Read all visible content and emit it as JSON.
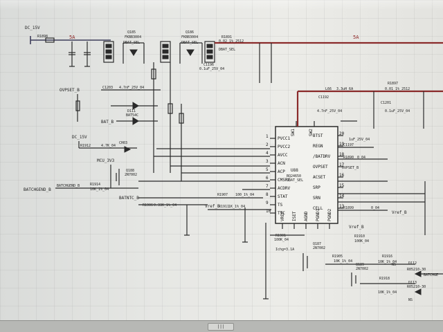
{
  "net": {
    "dc_15v_top": "DC_15V",
    "current_5a_left": "5A",
    "current_5a_right": "5A",
    "dbat_sel": "DBAT_SEL",
    "ovpset_b": "OVPSET_B",
    "bat_b": "BAT_B",
    "dc_15v_mid": "DC_15V",
    "mcu_3v3": "MCU_3V3",
    "batchgend_b": "BATCHGEND_B",
    "batntc_b": "BATNTC_B",
    "vref_b": "Vref_B",
    "ovpset_b_pin": "OVPSET_B",
    "batchge": "BATCHGE"
  },
  "ref": {
    "r1898": "R1898",
    "q185": "Q185",
    "q186": "Q186",
    "fkbb3004": "FKBB3004",
    "r1891": "R1891",
    "r1891_val": "0.02_1%_2512",
    "c1203": "C1203",
    "c1203_val": "4.7nF_25V_04",
    "c1196": "C1196",
    "c1196_val": "0.1uF_25V_04",
    "d111": "D111",
    "d111_part": "BAT54C",
    "r1912": "R1912",
    "r1912_val": "4.7K_04",
    "ch03": "CH03",
    "q188": "Q188",
    "q188_part": "2N7002",
    "r1914": "R1914",
    "r1914_val": "10K_1%_04",
    "r1906": "R1906",
    "r1906_val": "0.33K_1%_04",
    "r1907": "R1907",
    "r1907_val": "100_1%_04",
    "r1911": "R1911",
    "r1911_val": "1K_1%_04",
    "l66": "L66",
    "l66_val": "3.3uH_6A",
    "r1897": "R1897",
    "r1897_val": "0.01_1%_2512",
    "c1192": "C1192",
    "c1192_val": "4.7nF_25V_04",
    "c1201": "C1201",
    "c1201_val": "0.1uF_25V_04",
    "c1197": "C1197",
    "c1197_val": "1uF_25V_04",
    "r1899": "R1899",
    "r1899_val": "0_04",
    "r1901": "R1901",
    "r1901_val": "100K_04",
    "ichg": "Ichg=3.1A",
    "q187": "Q187",
    "q187_part": "2N7002",
    "r1905": "R1905",
    "r1905_val": "10K_1%_04",
    "q189": "Q189",
    "q189_part": "2N7002",
    "r1916": "R1916",
    "r1916_val": "10K_1%_04",
    "r1910": "R1910",
    "r1910_val": "100K_04",
    "r1918": "R1918",
    "r1918_val": "10K_1%_04",
    "d112": "D112",
    "d112_part": "R05210-30",
    "d113": "D113",
    "d113_part": "R05210-30",
    "ns1": "NS",
    "ns2": "NS",
    "r1890": "R1890",
    "r1890_val": "0_04"
  },
  "ic": {
    "ref": "U88",
    "part": "BQ24650",
    "part2": "DBAT_SEL",
    "left_pins": [
      {
        "num": "1",
        "name": "PVCC1"
      },
      {
        "num": "2",
        "name": "PVCC2"
      },
      {
        "num": "4",
        "name": "AVCC"
      },
      {
        "num": "3",
        "name": "ACN"
      },
      {
        "num": "5",
        "name": "ACP"
      },
      {
        "num": "6",
        "name": "CMSRC"
      },
      {
        "num": "7",
        "name": "ACDRV"
      },
      {
        "num": "8",
        "name": "STAT"
      },
      {
        "num": "9",
        "name": "TS"
      },
      {
        "num": "10",
        "name": "TTC"
      }
    ],
    "right_pins": [
      {
        "num": "20",
        "name": "BTST"
      },
      {
        "num": "19",
        "name": "REGN"
      },
      {
        "num": "18",
        "name": "/BATDRV"
      },
      {
        "num": "17",
        "name": "OVPSET"
      },
      {
        "num": "16",
        "name": "ACSET"
      },
      {
        "num": "15",
        "name": "SRP"
      },
      {
        "num": "14",
        "name": "SRN"
      },
      {
        "num": "13",
        "name": "CELL"
      }
    ],
    "top_pins": [
      {
        "name": "SW1"
      },
      {
        "name": "SW2"
      }
    ],
    "bottom_pins": [
      {
        "name": "VREF"
      },
      {
        "name": "ISET"
      },
      {
        "name": "AGND"
      },
      {
        "name": "PGND1"
      },
      {
        "name": "PGND2"
      }
    ]
  },
  "scrollbar": {
    "thumb_label": "|||"
  }
}
